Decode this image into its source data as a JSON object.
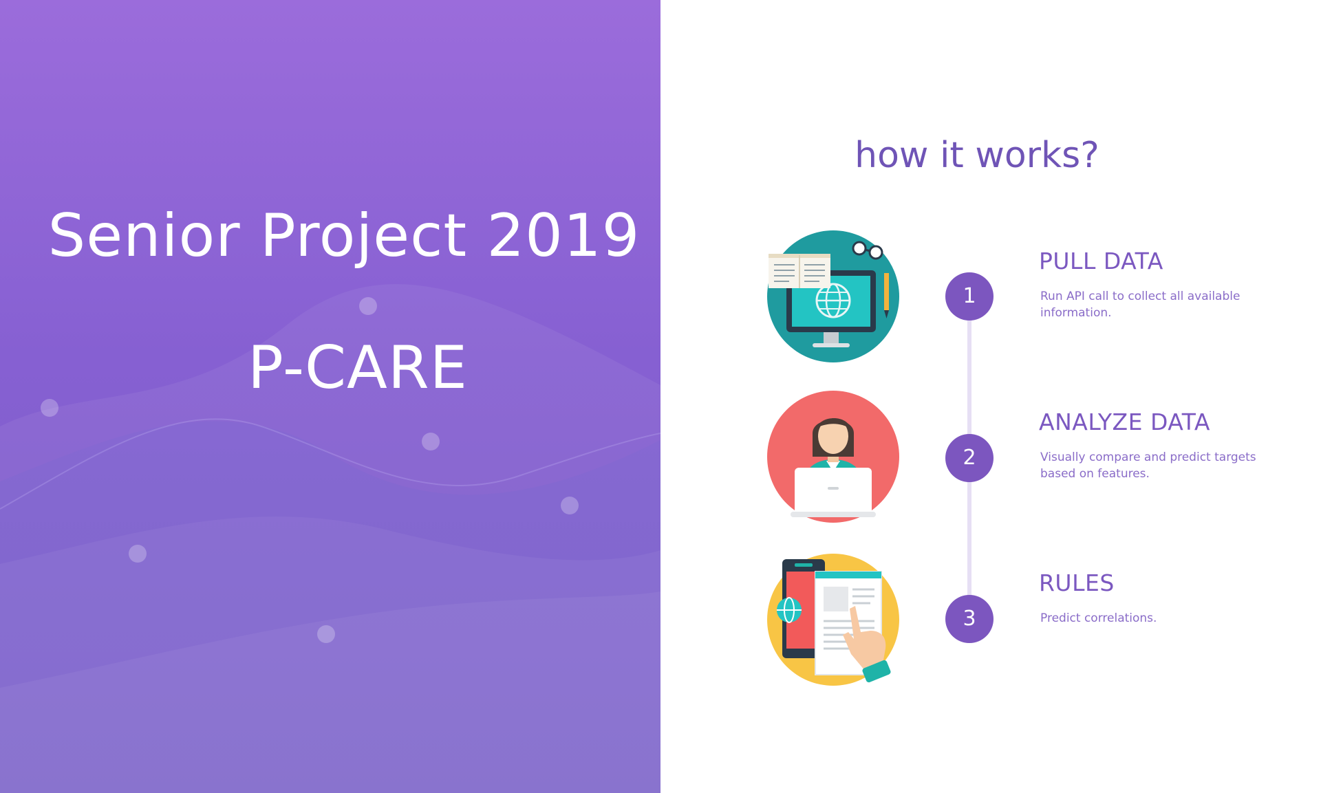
{
  "left": {
    "title": "Senior Project 2019",
    "subtitle": "P-CARE"
  },
  "right": {
    "heading": "how it works?",
    "steps": [
      {
        "number": "1",
        "title": "PULL DATA",
        "description": "Run API call to collect all available information.",
        "icon": "computer-book-icon"
      },
      {
        "number": "2",
        "title": "ANALYZE DATA",
        "description": "Visually compare and predict targets based on features.",
        "icon": "person-laptop-icon"
      },
      {
        "number": "3",
        "title": "RULES",
        "description": "Predict correlations.",
        "icon": "phone-document-icon"
      }
    ]
  },
  "colors": {
    "left_gradient_top": "#9b6cdb",
    "left_gradient_bottom": "#7a5cc6",
    "accent_purple": "#7c56bf",
    "heading_purple": "#6f54b6",
    "timeline": "#e6dff4"
  }
}
